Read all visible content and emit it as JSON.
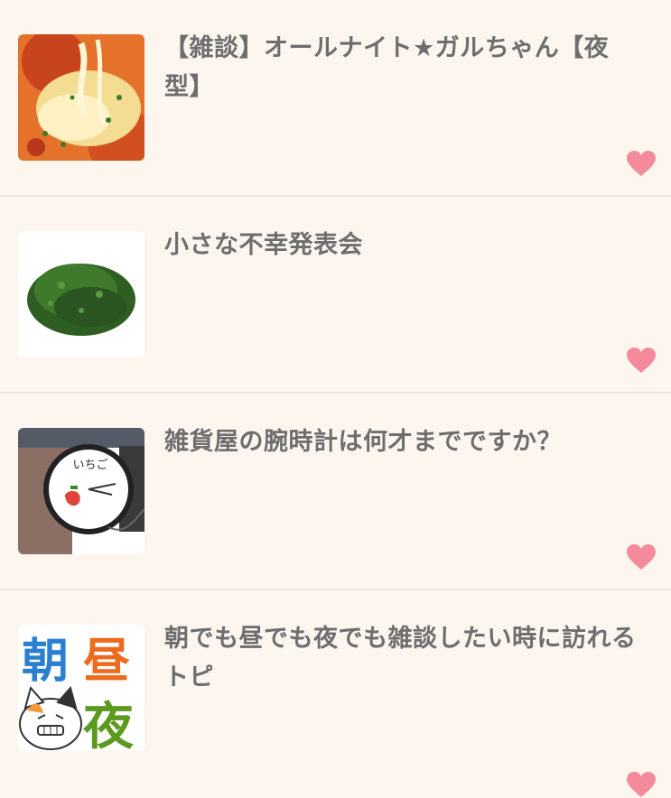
{
  "topics": [
    {
      "title": "【雑談】オールナイト★ガルちゃん【夜型】",
      "thumbnail": "pizza-cheese-photo",
      "favorite_icon": "heart-icon"
    },
    {
      "title": "小さな不幸発表会",
      "thumbnail": "green-herb-pile-photo",
      "favorite_icon": "heart-icon"
    },
    {
      "title": "雑貨屋の腕時計は何才までですか？",
      "thumbnail": "strawberry-wristwatch-photo",
      "favorite_icon": "heart-icon",
      "watch_text": "いちご"
    },
    {
      "title": "朝でも昼でも夜でも雑談したい時に訪れるトピ",
      "thumbnail": "asa-hiru-yoru-cat-image",
      "favorite_icon": "heart-icon",
      "image_text": [
        "朝",
        "昼",
        "夜"
      ]
    }
  ],
  "colors": {
    "background": "#fdf6ef",
    "divider": "#efe7df",
    "title_text": "#6e6e6e",
    "heart": "#f48a9c"
  }
}
